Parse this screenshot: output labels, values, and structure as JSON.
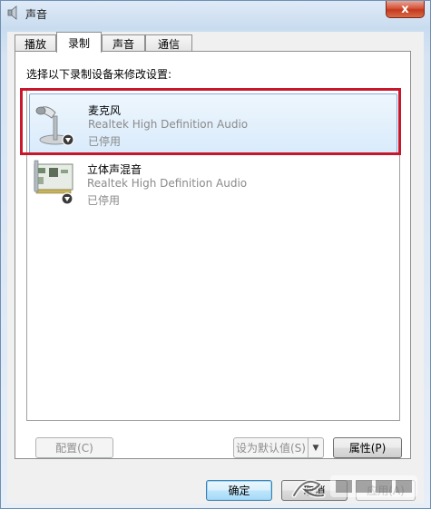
{
  "window": {
    "title": "声音",
    "close_label": "x"
  },
  "tabs": [
    {
      "label": "播放",
      "active": false
    },
    {
      "label": "录制",
      "active": true
    },
    {
      "label": "声音",
      "active": false
    },
    {
      "label": "通信",
      "active": false
    }
  ],
  "panel": {
    "instruction": "选择以下录制设备来修改设置:"
  },
  "devices": [
    {
      "name": "麦克风",
      "driver": "Realtek High Definition Audio",
      "status": "已停用",
      "icon": "microphone-icon",
      "selected": true
    },
    {
      "name": "立体声混音",
      "driver": "Realtek High Definition Audio",
      "status": "已停用",
      "icon": "sound-card-icon",
      "selected": false
    }
  ],
  "buttons": {
    "configure": "配置(C)",
    "set_default": "设为默认值(S)",
    "properties": "属性(P)",
    "ok": "确定",
    "cancel": "取消",
    "apply": "应用(A)"
  },
  "colors": {
    "highlight_box": "#c8172a",
    "selection": "#d9ebfb",
    "disabled_text": "#8a8a8a"
  }
}
